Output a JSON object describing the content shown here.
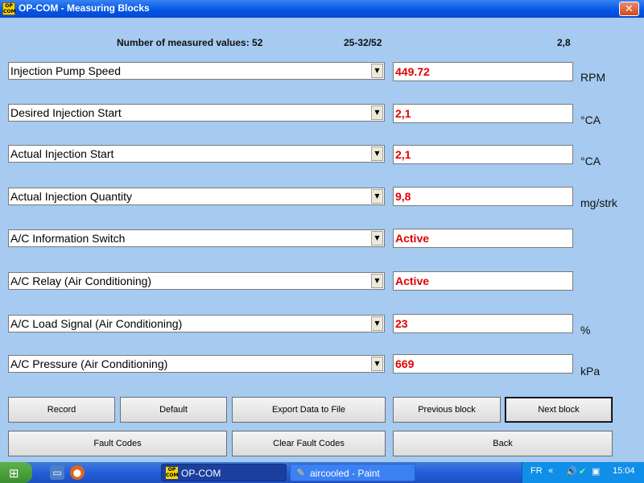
{
  "window": {
    "title": "OP-COM - Measuring Blocks",
    "icon_text": "OP\nCOM",
    "close_glyph": "✕"
  },
  "header": {
    "count_label": "Number of measured values: 52",
    "range": "25-32/52",
    "value": "2,8"
  },
  "rows": [
    {
      "label": "Injection Pump Speed",
      "value": "449.72",
      "unit": "RPM"
    },
    {
      "label": "Desired Injection Start",
      "value": "2,1",
      "unit": "°CA"
    },
    {
      "label": "Actual Injection Start",
      "value": "2,1",
      "unit": "°CA"
    },
    {
      "label": "Actual Injection Quantity",
      "value": "9,8",
      "unit": "mg/strk"
    },
    {
      "label": "A/C Information Switch",
      "value": "Active",
      "unit": ""
    },
    {
      "label": "A/C Relay (Air Conditioning)",
      "value": "Active",
      "unit": ""
    },
    {
      "label": "A/C Load Signal (Air Conditioning)",
      "value": "23",
      "unit": "%"
    },
    {
      "label": "A/C Pressure (Air Conditioning)",
      "value": "669",
      "unit": "kPa"
    }
  ],
  "buttons": {
    "record": "Record",
    "default": "Default",
    "export": "Export Data to File",
    "previous": "Previous block",
    "next": "Next block",
    "fault_codes": "Fault Codes",
    "clear_fault_codes": "Clear Fault Codes",
    "back": "Back"
  },
  "taskbar": {
    "task1": "OP-COM",
    "task2": "aircooled - Paint",
    "lang": "FR",
    "chevron": "«",
    "clock": "15:04"
  },
  "colors": {
    "background": "#a6caf0",
    "value_text": "#e00000",
    "titlebar": "#0055e5",
    "taskbar": "#245edb"
  }
}
